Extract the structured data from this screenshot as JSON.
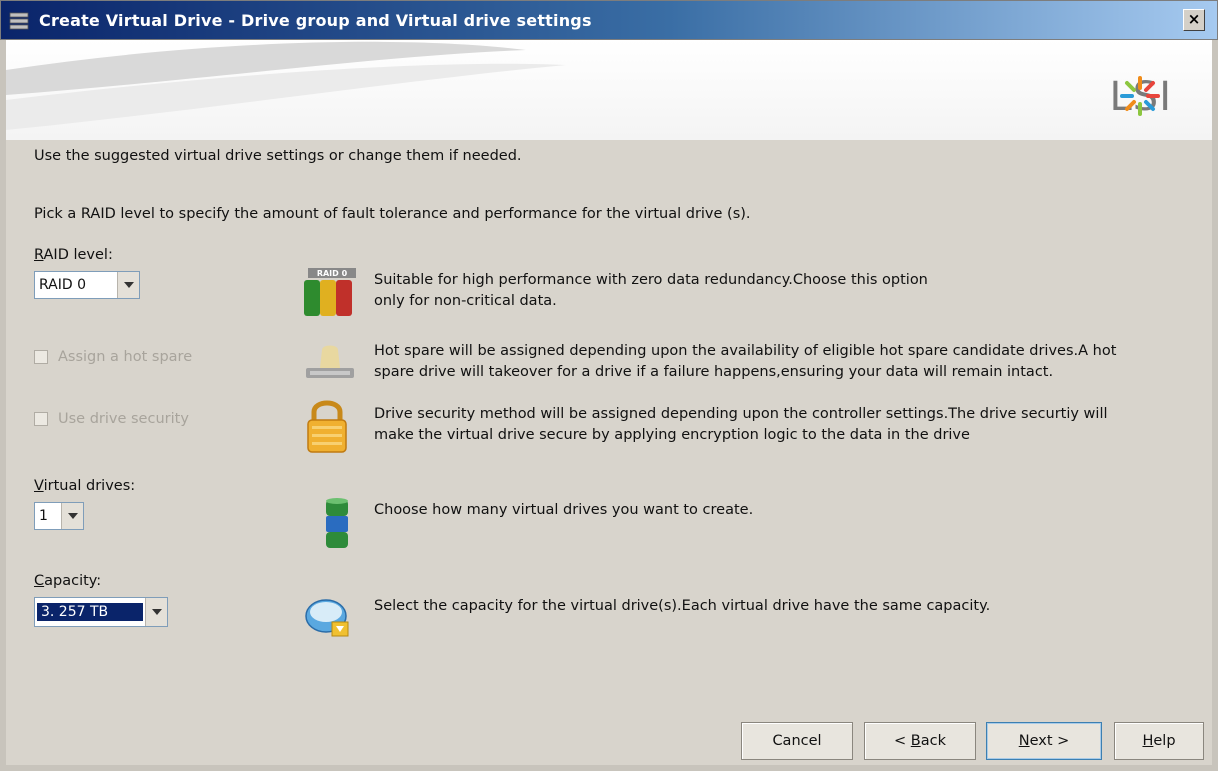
{
  "window": {
    "title": "Create Virtual Drive - Drive group and Virtual drive settings",
    "close_label": "×"
  },
  "banner": {
    "logo_text": "LSI"
  },
  "intro": {
    "line1": "Use the suggested virtual drive settings or change them if needed.",
    "line2": "Pick a RAID level to specify the amount of fault tolerance and performance for the virtual drive (s)."
  },
  "raid": {
    "label_first": "R",
    "label_rest": "AID level:",
    "value": "RAID 0",
    "icon_badge": "RAID 0",
    "desc_line1": "Suitable for high performance with zero data redundancy.Choose this option",
    "desc_line2": "only for non-critical data."
  },
  "hot_spare": {
    "label": "Assign a hot spare",
    "checked": false,
    "enabled": false,
    "desc_line1": "Hot spare will be assigned depending upon the availability of eligible hot spare candidate drives.A hot",
    "desc_line2": "spare drive will takeover for a drive if a failure happens,ensuring your data will remain intact."
  },
  "drive_security": {
    "label": "Use drive security",
    "checked": false,
    "enabled": false,
    "desc_line1": "Drive security method will be assigned depending upon the controller settings.The drive securtiy will",
    "desc_line2": "make the virtual drive secure by applying encryption logic to the data in the drive"
  },
  "virtual_drives": {
    "label_first": "V",
    "label_rest": "irtual drives:",
    "value": "1",
    "desc": "Choose how many virtual drives you want to create."
  },
  "capacity": {
    "label_first": "C",
    "label_rest": "apacity:",
    "value": "3. 257 TB",
    "desc": "Select the capacity for the virtual drive(s).Each virtual drive have the same capacity."
  },
  "buttons": {
    "cancel": "Cancel",
    "back_prefix": "< ",
    "back_mnemonic": "B",
    "back_rest": "ack",
    "next_mnemonic": "N",
    "next_rest": "ext >",
    "help_mnemonic": "H",
    "help_rest": "elp"
  },
  "colors": {
    "title_gradient_start": "#0a246a",
    "selection": "#0a246a",
    "dialog_bg": "#d8d4cc"
  }
}
